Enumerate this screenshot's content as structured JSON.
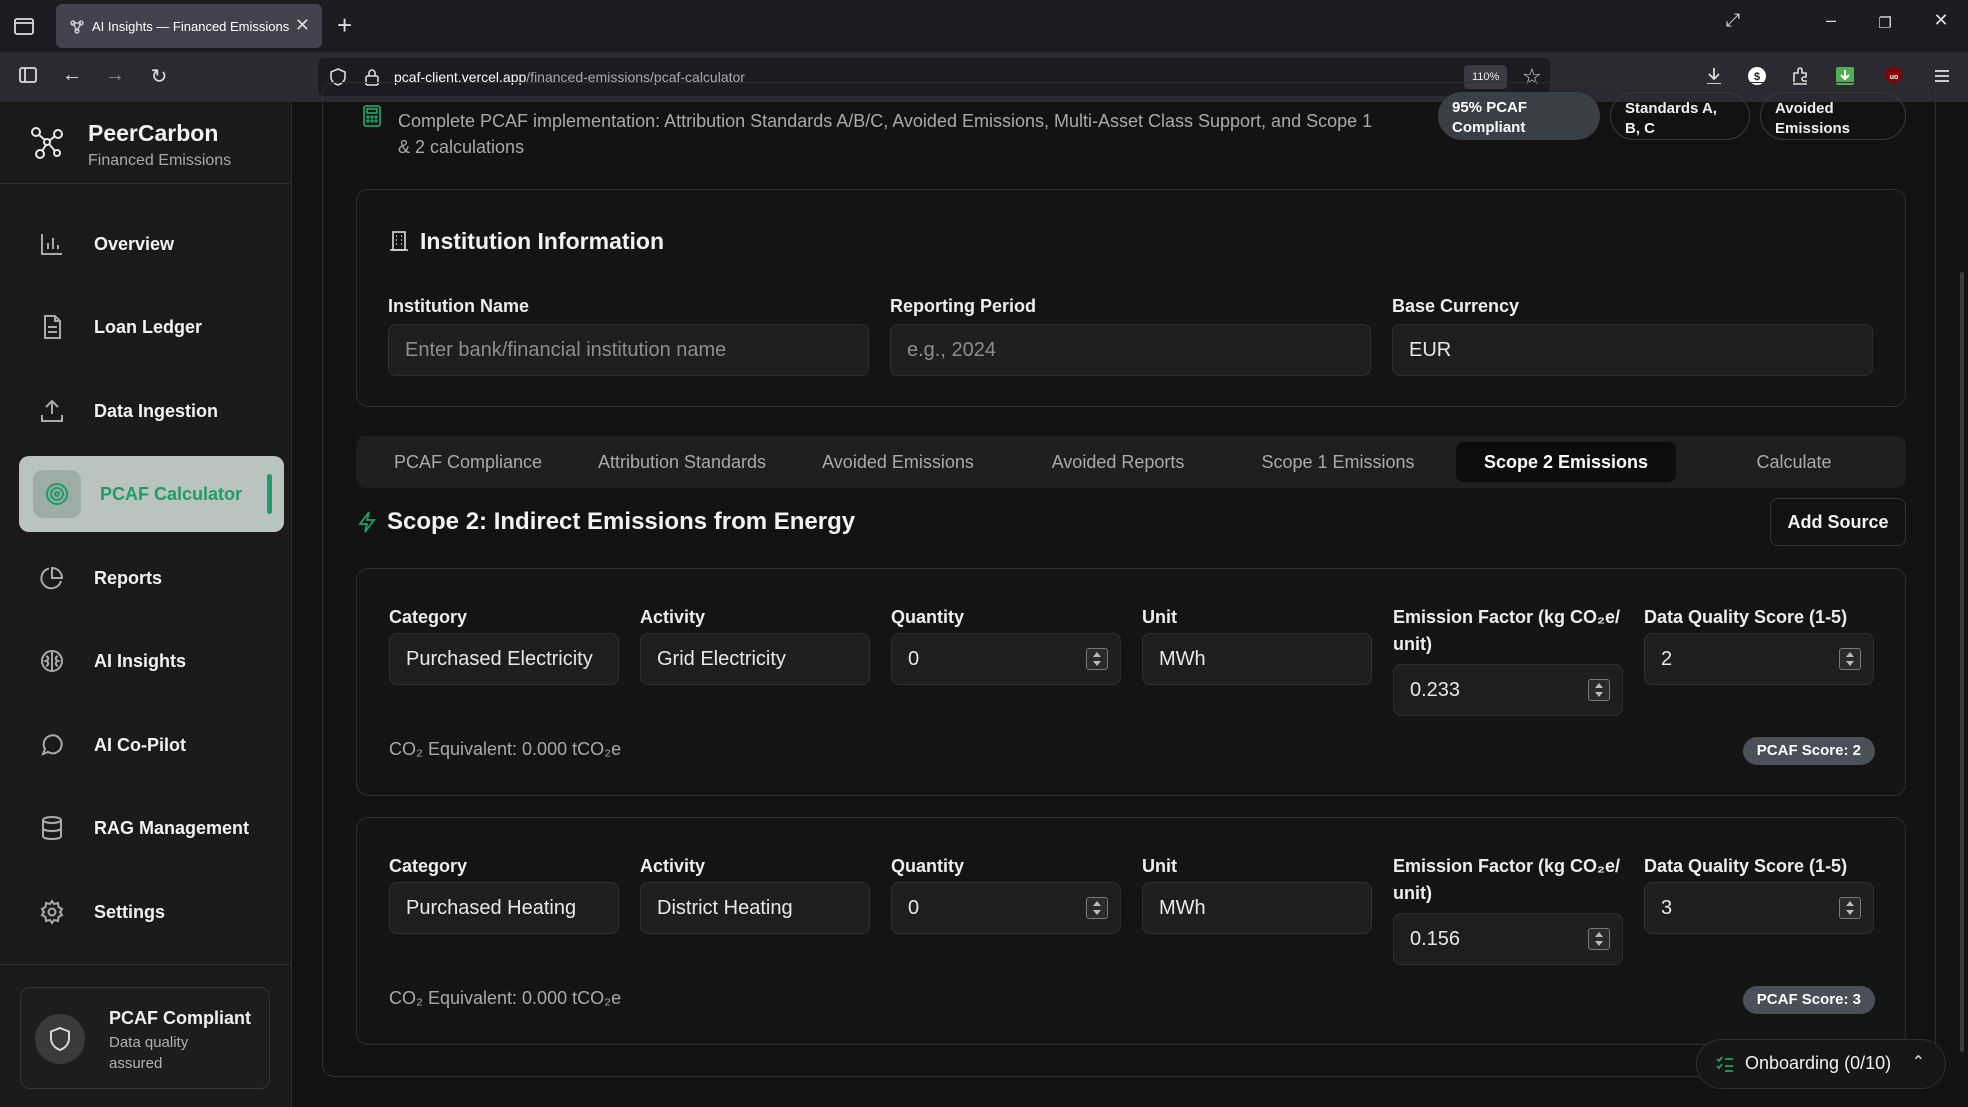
{
  "browser": {
    "tab_title": "AI Insights — Financed Emissions",
    "url_host": "pcaf-client.vercel.app",
    "url_path": "/financed-emissions/pcaf-calculator",
    "zoom": "110%"
  },
  "sidebar": {
    "brand_name": "PeerCarbon",
    "brand_sub": "Financed Emissions",
    "items": [
      {
        "label": "Overview",
        "icon": "bar-chart-icon"
      },
      {
        "label": "Loan Ledger",
        "icon": "document-icon"
      },
      {
        "label": "Data Ingestion",
        "icon": "upload-icon"
      },
      {
        "label": "PCAF Calculator",
        "icon": "target-icon",
        "active": true
      },
      {
        "label": "Reports",
        "icon": "pie-chart-icon"
      },
      {
        "label": "AI Insights",
        "icon": "brain-icon"
      },
      {
        "label": "AI Co-Pilot",
        "icon": "chat-icon"
      },
      {
        "label": "RAG Management",
        "icon": "database-icon"
      },
      {
        "label": "Settings",
        "icon": "gear-icon"
      }
    ],
    "compliant_title": "PCAF Compliant",
    "compliant_sub": "Data quality assured"
  },
  "header": {
    "description": "Complete PCAF implementation: Attribution Standards A/B/C, Avoided Emissions, Multi-Asset Class Support, and Scope 1 & 2 calculations",
    "pills": [
      "95% PCAF Compliant",
      "Standards A, B, C",
      "Avoided Emissions"
    ]
  },
  "institution": {
    "title": "Institution Information",
    "name_label": "Institution Name",
    "name_placeholder": "Enter bank/financial institution name",
    "period_label": "Reporting Period",
    "period_placeholder": "e.g., 2024",
    "currency_label": "Base Currency",
    "currency_value": "EUR"
  },
  "tabs": [
    "PCAF Compliance",
    "Attribution Standards",
    "Avoided Emissions",
    "Avoided Reports",
    "Scope 1 Emissions",
    "Scope 2 Emissions",
    "Calculate"
  ],
  "active_tab": "Scope 2 Emissions",
  "scope2": {
    "title": "Scope 2: Indirect Emissions from Energy",
    "add_source": "Add Source",
    "labels": {
      "category": "Category",
      "activity": "Activity",
      "quantity": "Quantity",
      "unit": "Unit",
      "factor_line1": "Emission Factor (kg CO₂e/",
      "factor_line2": "unit)",
      "dq": "Data Quality Score (1-5)"
    },
    "sources": [
      {
        "category": "Purchased Electricity",
        "activity": "Grid Electricity",
        "quantity": "0",
        "unit": "MWh",
        "factor": "0.233",
        "dq": "2",
        "co2": "CO₂ Equivalent: 0.000 tCO₂e",
        "score": "PCAF Score: 2"
      },
      {
        "category": "Purchased Heating",
        "activity": "District Heating",
        "quantity": "0",
        "unit": "MWh",
        "factor": "0.156",
        "dq": "3",
        "co2": "CO₂ Equivalent: 0.000 tCO₂e",
        "score": "PCAF Score: 3"
      }
    ]
  },
  "onboarding": "Onboarding (0/10)",
  "colors": {
    "accent": "#1f9d68",
    "active_nav_bg": "#b9c4bf"
  }
}
